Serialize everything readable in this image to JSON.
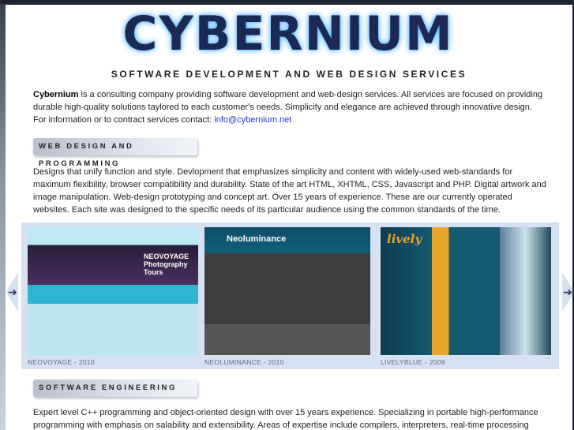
{
  "logo": {
    "text": "CYBERNIUM"
  },
  "tagline": "SOFTWARE DEVELOPMENT AND WEB DESIGN SERVICES",
  "intro": {
    "brand": "Cybernium",
    "text": " is a consulting company providing software development and web-design services. All services are focused on providing durable high-quality solutions taylored to each customer's needs. Simplicity and elegance are achieved through innovative design. For information or to contract services contact: ",
    "email": "info@cybernium.net"
  },
  "web_section": {
    "heading": "WEB DESIGN AND PROGRAMMING",
    "text": "Designs that unify function and style. Devlopment that emphasizes simplicity and content with widely-used web-standards for maximum flexibility, browser compatibility and durability. State of the art HTML, XHTML, CSS, Javascript and PHP. Digital artwork and image manipulation. Web-design prototyping and concept art. Over 15 years of experience. These are our currently operated websites. Each site was designed to the specific needs of its particular audience using the common standards of the time."
  },
  "carousel": {
    "items": [
      {
        "caption": "NEOVOYAGE - 2010",
        "thumb_label": "NEOVOYAGE Photography Tours"
      },
      {
        "caption": "NEOLUMINANCE - 2010",
        "thumb_label": "Neoluminance"
      },
      {
        "caption": "LIVELYBLUE - 2009",
        "thumb_label": "lively"
      }
    ],
    "prev_icon": "arrow-left-icon",
    "next_icon": "arrow-right-icon"
  },
  "software_section": {
    "heading": "SOFTWARE ENGINEERING",
    "text": "Expert level C++ programming and object-oriented design with over 15 years experience. Specializing in portable high-performance programming with emphasis on salability and extensibility. Areas of expertise include compilers, interpreters, real-time processing systems,"
  }
}
